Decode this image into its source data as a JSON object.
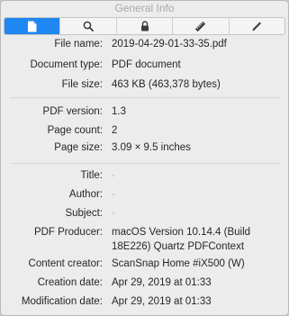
{
  "window": {
    "title": "General Info"
  },
  "toolbar": {
    "tabs": [
      {
        "icon": "document-icon",
        "active": true
      },
      {
        "icon": "search-icon",
        "active": false
      },
      {
        "icon": "lock-icon",
        "active": false
      },
      {
        "icon": "ruler-icon",
        "active": false
      },
      {
        "icon": "pen-icon",
        "active": false
      }
    ],
    "accent_color": "#1f87f2"
  },
  "file": {
    "name_label": "File name:",
    "name": "2019-04-29-01-33-35.pdf",
    "type_label": "Document type:",
    "type": "PDF document",
    "size_label": "File size:",
    "size": "463 KB (463,378 bytes)"
  },
  "pdf": {
    "version_label": "PDF version:",
    "version": "1.3",
    "page_count_label": "Page count:",
    "page_count": "2",
    "page_size_label": "Page size:",
    "page_size": "3.09 × 9.5 inches"
  },
  "meta": {
    "title_label": "Title:",
    "title": "-",
    "author_label": "Author:",
    "author": "-",
    "subject_label": "Subject:",
    "subject": "-",
    "producer_label": "PDF Producer:",
    "producer": "macOS Version 10.14.4 (Build 18E226) Quartz PDFContext",
    "creator_label": "Content creator:",
    "creator": "ScanSnap Home #iX500 (W)",
    "created_label": "Creation date:",
    "created": "Apr 29, 2019 at 01:33",
    "modified_label": "Modification date:",
    "modified": "Apr 29, 2019 at 01:33"
  }
}
